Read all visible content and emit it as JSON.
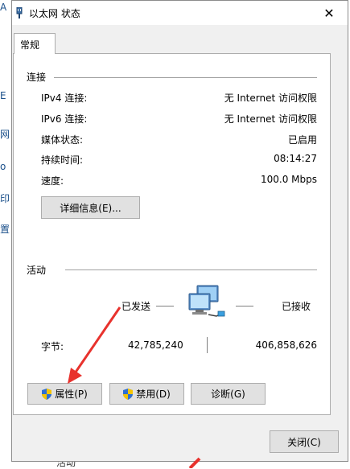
{
  "background": {
    "left_glyphs": [
      "A",
      "E",
      "网",
      "o",
      "印",
      "置"
    ],
    "bottom_text": "活动"
  },
  "window": {
    "title": "以太网 状态",
    "close_glyph": "✕"
  },
  "tabs": [
    {
      "label": "常规"
    }
  ],
  "connection": {
    "section_title": "连接",
    "rows": [
      {
        "label": "IPv4 连接:",
        "value": "无 Internet 访问权限"
      },
      {
        "label": "IPv6 连接:",
        "value": "无 Internet 访问权限"
      },
      {
        "label": "媒体状态:",
        "value": "已启用"
      },
      {
        "label": "持续时间:",
        "value": "08:14:27"
      },
      {
        "label": "速度:",
        "value": "100.0 Mbps"
      }
    ],
    "details_button": "详细信息(E)..."
  },
  "activity": {
    "section_title": "活动",
    "sent_label": "已发送",
    "received_label": "已接收",
    "bytes_label": "字节:",
    "bytes_sent": "42,785,240",
    "bytes_received": "406,858,626",
    "network_icon": "network-computers-icon"
  },
  "buttons": {
    "properties": "属性(P)",
    "disable": "禁用(D)",
    "diagnose": "诊断(G)",
    "close": "关闭(C)"
  },
  "colors": {
    "accent": "#0078d7",
    "annotation_arrow": "#e8322d"
  }
}
